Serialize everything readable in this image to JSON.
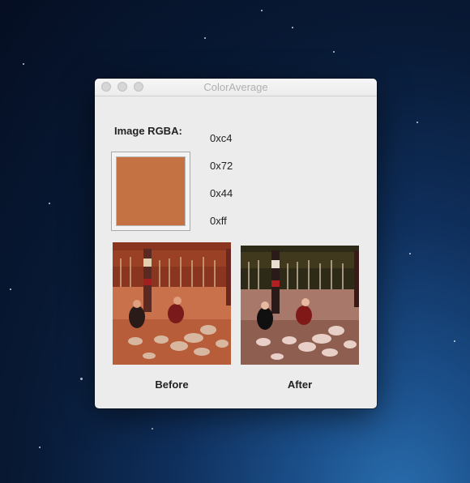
{
  "window": {
    "title": "ColorAverage"
  },
  "rgba": {
    "label": "Image RGBA:",
    "values": [
      "0xc4",
      "0x72",
      "0x44",
      "0xff"
    ],
    "swatch_color": "#c47244"
  },
  "images": {
    "before_caption": "Before",
    "after_caption": "After"
  },
  "colors": {
    "window_bg": "#ececec",
    "desktop": "#0f2f5c"
  }
}
